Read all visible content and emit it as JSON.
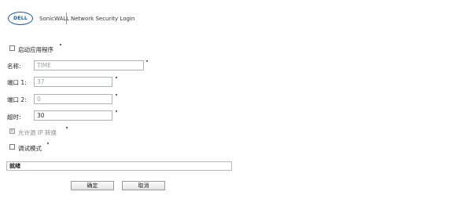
{
  "header": {
    "logo_text": "DELL",
    "brand": "SonicWALL",
    "title": "Network Security Login"
  },
  "form": {
    "enable_app": {
      "label": "启动应用程序",
      "checked": false
    },
    "name": {
      "label": "名称:",
      "value": "TIME"
    },
    "port1": {
      "label": "端口 1:",
      "value": "37"
    },
    "port2": {
      "label": "端口 2:",
      "value": "0"
    },
    "timeout": {
      "label": "超时:",
      "value": "30"
    },
    "allow_ip_translation": {
      "label": "允许源 IP 转换",
      "checked": true
    },
    "debug_mode": {
      "label": "调试模式",
      "checked": false
    }
  },
  "status": {
    "text": "就绪"
  },
  "buttons": {
    "ok": "确定",
    "cancel": "取消"
  },
  "colors": {
    "brand_blue": "#1b5aa8",
    "field_border": "#aeb3b8"
  }
}
